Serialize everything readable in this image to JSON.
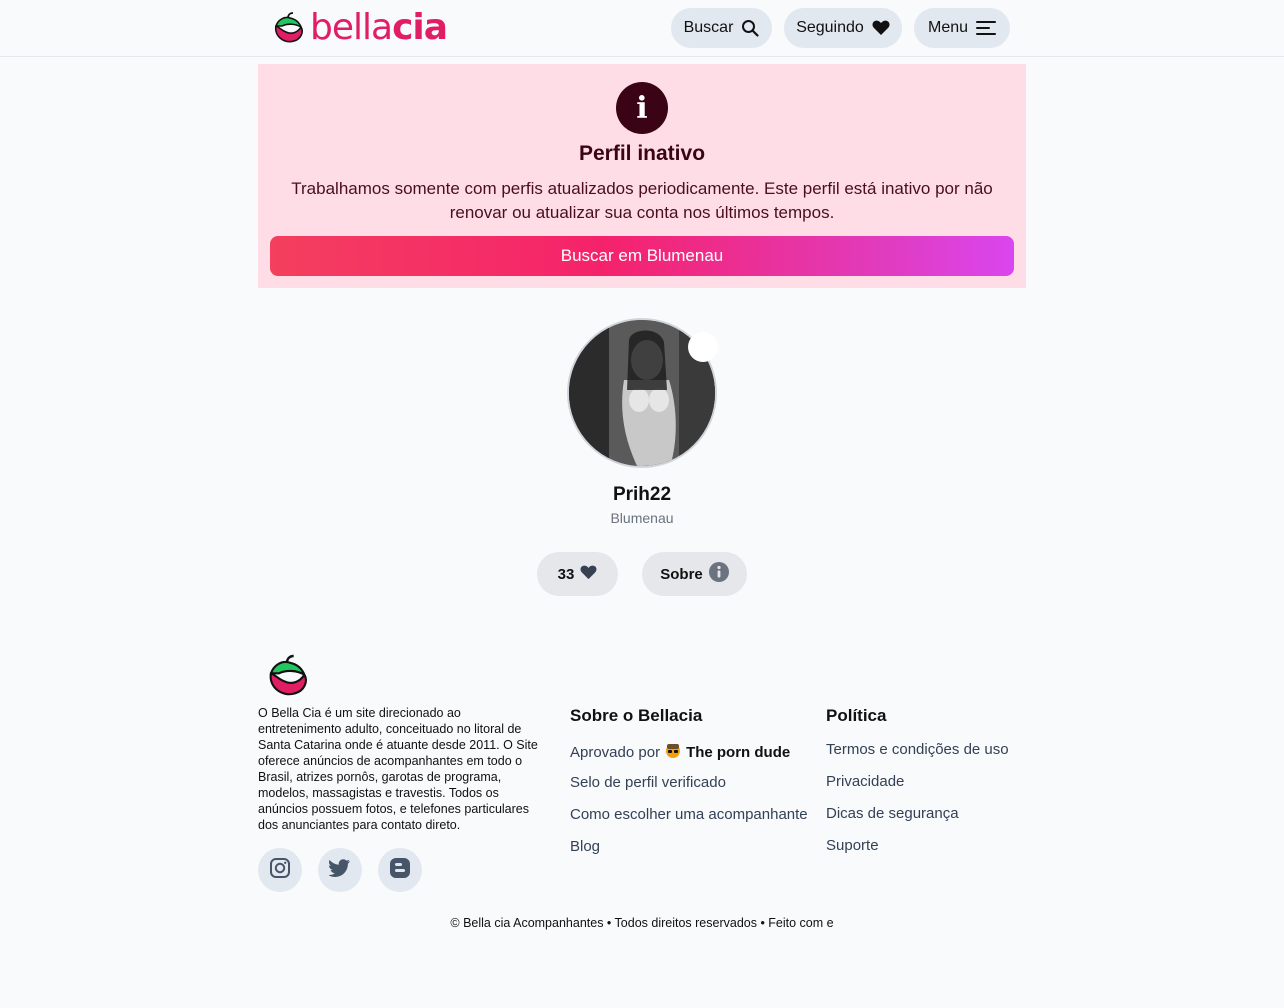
{
  "header": {
    "logo_text_light": "bella",
    "logo_text_bold": "cia",
    "search_label": "Buscar",
    "following_label": "Seguindo",
    "menu_label": "Menu"
  },
  "banner": {
    "icon": "i",
    "title": "Perfil inativo",
    "text": "Trabalhamos somente com perfis atualizados periodicamente. Este perfil está inativo por não renovar ou atualizar sua conta nos últimos tempos.",
    "button_label": "Buscar em Blumenau"
  },
  "profile": {
    "name": "Prih22",
    "city": "Blumenau",
    "likes": "33",
    "about_label": "Sobre"
  },
  "footer": {
    "about_text": "O Bella Cia é um site direcionado ao entretenimento adulto, conceituado no litoral de Santa Catarina onde é atuante desde 2011. O Site oferece anúncios de acompanhantes em todo o Brasil, atrizes pornôs, garotas de programa, modelos, massagistas e travestis. Todos os anúncios possuem fotos, e telefones particulares dos anunciantes para contato direto.",
    "col1": {
      "title": "Sobre o Bellacia",
      "approved_prefix": "Aprovado por",
      "approved_name": "The porn dude",
      "links": [
        "Selo de perfil verificado",
        "Como escolher uma acompanhante",
        "Blog"
      ]
    },
    "col2": {
      "title": "Política",
      "links": [
        "Termos e condições de uso",
        "Privacidade",
        "Dicas de segurança",
        "Suporte"
      ]
    },
    "social": [
      "instagram-icon",
      "twitter-icon",
      "blogger-icon"
    ],
    "copyright": "© Bella cia Acompanhantes • Todos direitos reservados • Feito com  e "
  },
  "colors": {
    "brand": "#e11d63",
    "banner_bg": "#fedde7",
    "info_icon_bg": "#3b0416"
  }
}
